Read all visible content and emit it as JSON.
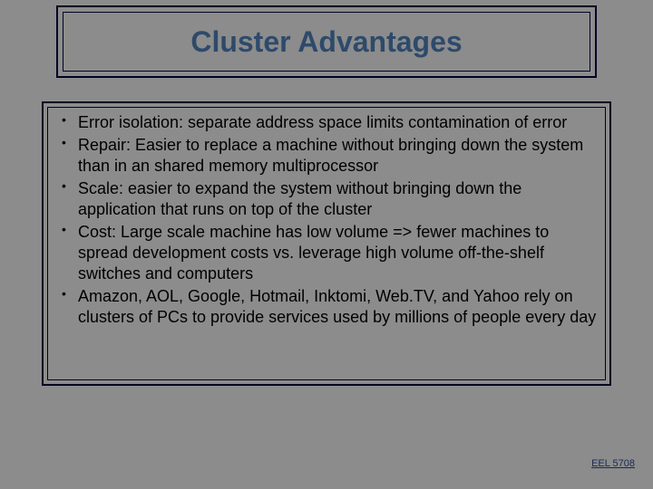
{
  "title": "Cluster Advantages",
  "bullets": [
    "Error isolation: separate address space limits contamination of error",
    "Repair: Easier to replace a machine without bringing down the system than in an shared memory multiprocessor",
    "Scale: easier to expand the system without bringing down the application that runs on top of the cluster",
    "Cost: Large scale machine has low volume => fewer machines to spread development costs vs. leverage high volume off-the-shelf switches and computers",
    "Amazon, AOL, Google, Hotmail, Inktomi, Web.TV, and Yahoo rely on clusters of PCs to provide services used by millions of people every day"
  ],
  "footer": "EEL 5708"
}
